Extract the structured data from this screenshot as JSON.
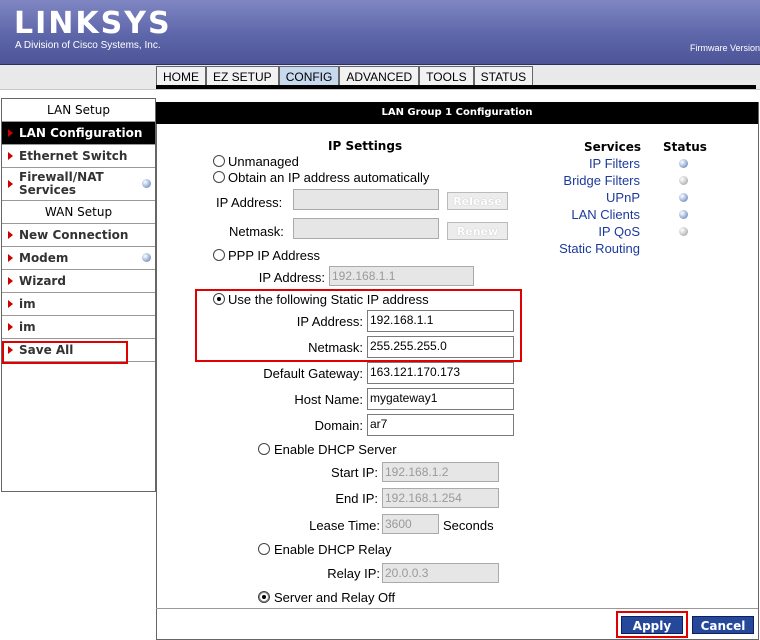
{
  "brand": {
    "logo": "LINKSYS",
    "tagline": "A Division of Cisco Systems, Inc.",
    "firmware_label": "Firmware Version"
  },
  "nav": {
    "tabs": [
      "HOME",
      "EZ SETUP",
      "CONFIG",
      "ADVANCED",
      "TOOLS",
      "STATUS"
    ],
    "active": "CONFIG"
  },
  "sidebar": {
    "lan_header": "LAN Setup",
    "wan_header": "WAN Setup",
    "items": {
      "lan_configuration": "LAN Configuration",
      "ethernet_switch": "Ethernet Switch",
      "firewall_nat": "Firewall/NAT Services",
      "new_connection": "New Connection",
      "modem": "Modem",
      "wizard": "Wizard",
      "im1": "im",
      "im2": "im",
      "save_all": "Save All"
    }
  },
  "content": {
    "title": "LAN Group 1 Configuration",
    "ip_settings_header": "IP Settings",
    "unmanaged": "Unmanaged",
    "obtain_auto": "Obtain an IP address automatically",
    "auto_ip_label": "IP Address:",
    "auto_netmask_label": "Netmask:",
    "auto_ip_value": "",
    "auto_netmask_value": "",
    "release_button": "Release",
    "renew_button": "Renew",
    "ppp_label": "PPP IP Address",
    "ppp_ip_label": "IP Address:",
    "ppp_ip_value": "192.168.1.1",
    "static_label": "Use the following Static IP address",
    "static_ip_label": "IP Address:",
    "static_ip_value": "192.168.1.1",
    "static_netmask_label": "Netmask:",
    "static_netmask_value": "255.255.255.0",
    "gateway_label": "Default Gateway:",
    "gateway_value": "163.121.170.173",
    "hostname_label": "Host Name:",
    "hostname_value": "mygateway1",
    "domain_label": "Domain:",
    "domain_value": "ar7",
    "dhcp_server_label": "Enable DHCP Server",
    "start_ip_label": "Start IP:",
    "start_ip_value": "192.168.1.2",
    "end_ip_label": "End IP:",
    "end_ip_value": "192.168.1.254",
    "lease_label": "Lease Time:",
    "lease_value": "3600",
    "seconds_label": "Seconds",
    "dhcp_relay_label": "Enable DHCP Relay",
    "relay_ip_label": "Relay IP:",
    "relay_ip_value": "20.0.0.3",
    "server_relay_off_label": "Server and Relay Off"
  },
  "services": {
    "header": "Services",
    "status_header": "Status",
    "items": [
      {
        "name": "IP Filters",
        "status": "enabled"
      },
      {
        "name": "Bridge Filters",
        "status": "disabled"
      },
      {
        "name": "UPnP",
        "status": "enabled"
      },
      {
        "name": "LAN Clients",
        "status": "enabled"
      },
      {
        "name": "IP QoS",
        "status": "disabled"
      },
      {
        "name": "Static Routing",
        "status": null
      }
    ]
  },
  "footer": {
    "apply": "Apply",
    "cancel": "Cancel"
  },
  "colors": {
    "header": "#5e66aa",
    "highlight": "#e00000",
    "link": "#1c3a9c",
    "button": "#26489a"
  }
}
